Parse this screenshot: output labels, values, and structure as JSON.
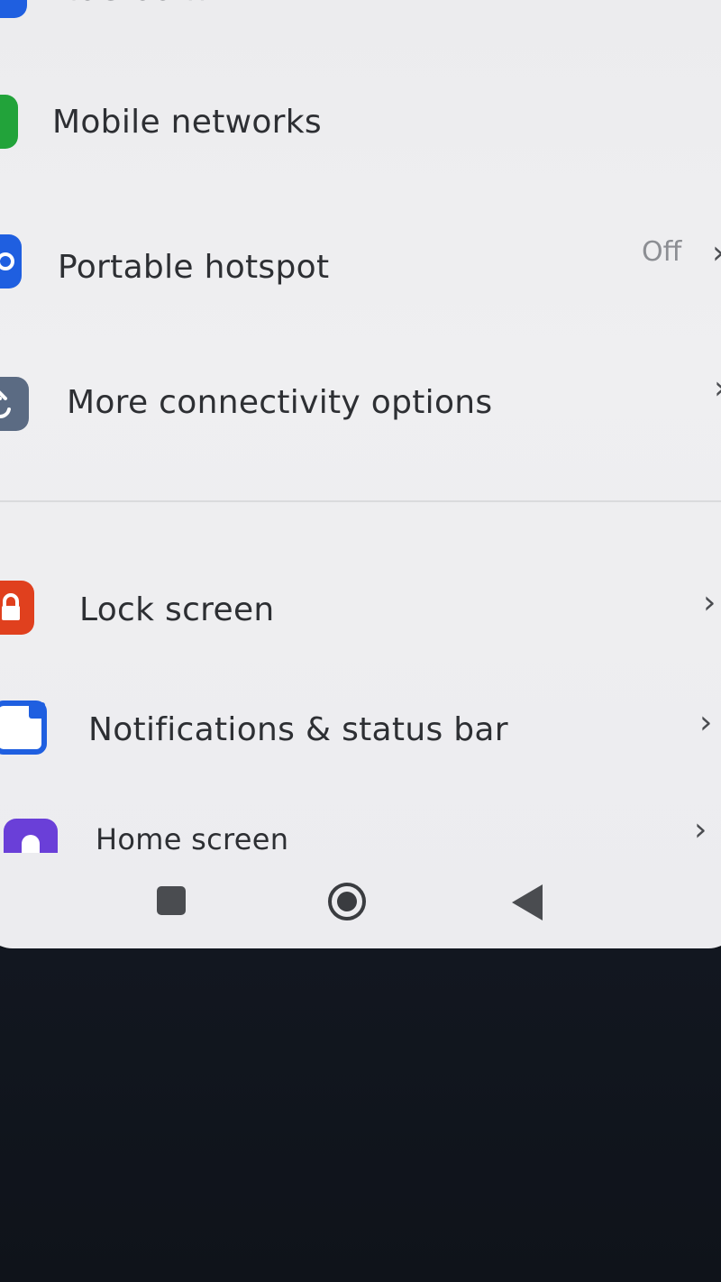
{
  "settings": {
    "items": [
      {
        "label": "Bluetooth",
        "icon": "bluetooth-icon",
        "icon_color": "#1f5fe0"
      },
      {
        "label": "Mobile networks",
        "icon": "mobile-networks-icon",
        "icon_color": "#22a33a"
      },
      {
        "label": "Portable hotspot",
        "value": "Off",
        "icon": "hotspot-icon",
        "icon_color": "#1f5fe0"
      },
      {
        "label": "More connectivity options",
        "icon": "connectivity-icon",
        "icon_color": "#5b6b83"
      },
      {
        "label": "Lock screen",
        "icon": "lock-icon",
        "icon_color": "#e0401e"
      },
      {
        "label": "Notifications & status bar",
        "icon": "notifications-icon",
        "icon_color": "#1f5fe0"
      },
      {
        "label": "Home screen",
        "icon": "home-screen-icon",
        "icon_color": "#6a3fd8"
      }
    ]
  },
  "navbar": {
    "recents": "recents-square-icon",
    "home": "home-circle-icon",
    "back": "back-triangle-icon"
  }
}
